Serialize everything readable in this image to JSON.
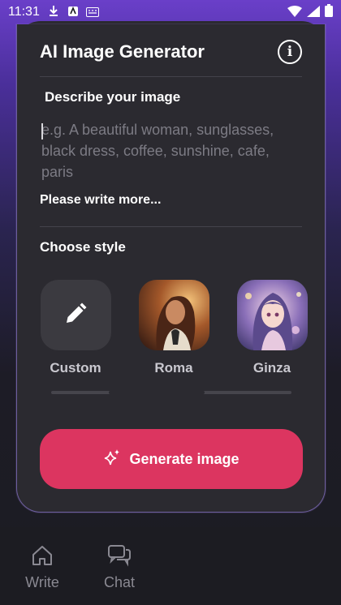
{
  "status_bar": {
    "time": "11:31"
  },
  "app": {
    "title": "AI Image Generator"
  },
  "prompt": {
    "section_label": "Describe your image",
    "placeholder": "e.g. A beautiful woman, sunglasses, black dress, coffee, sunshine, cafe, paris",
    "value": "",
    "hint": "Please write more..."
  },
  "styles": {
    "section_label": "Choose style",
    "items": [
      {
        "label": "Custom",
        "icon": "pencil-icon"
      },
      {
        "label": "Roma",
        "icon": "roma-thumbnail"
      },
      {
        "label": "Ginza",
        "icon": "ginza-thumbnail"
      }
    ],
    "scroll_position": 0.4
  },
  "generate": {
    "label": "Generate image",
    "icon": "sparkle-icon"
  },
  "nav": {
    "items": [
      {
        "label": "Write",
        "icon": "home-icon"
      },
      {
        "label": "Chat",
        "icon": "chat-icon"
      }
    ]
  },
  "colors": {
    "accent": "#dc3560",
    "card": "#2b2a30",
    "gradient_top": "#6a3fc9"
  }
}
